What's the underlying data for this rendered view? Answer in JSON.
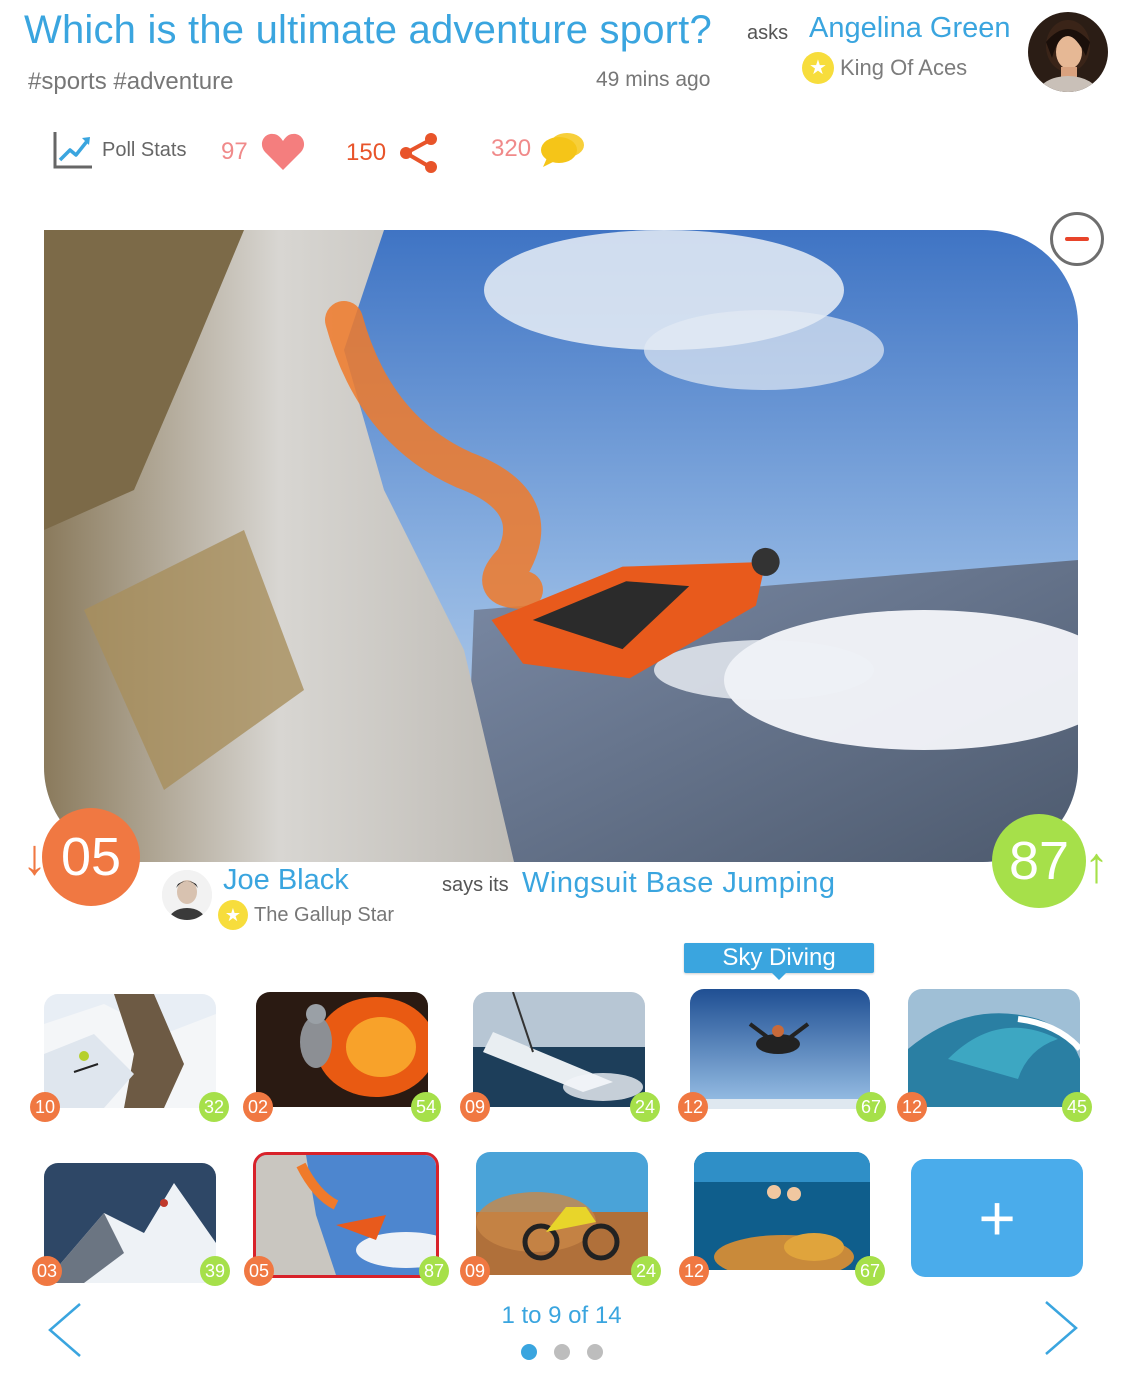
{
  "question": {
    "title": "Which is the ultimate adventure sport?",
    "asks_label": "asks",
    "hashtags": "#sports #adventure",
    "time_ago": "49 mins ago"
  },
  "author": {
    "name": "Angelina Green",
    "rank": "King Of Aces",
    "avatar_icon": "user-avatar-photo"
  },
  "stats": {
    "poll_stats_label": "Poll Stats",
    "likes": "97",
    "shares": "150",
    "comments": "320",
    "colors": {
      "likes": "#f08a8a",
      "shares": "#e8542a",
      "comments_bubble": "#f5c518"
    }
  },
  "main_entry": {
    "image_icon": "wingsuit-photo",
    "down_votes": "05",
    "up_votes": "87",
    "answerer_name": "Joe Black",
    "answerer_rank": "The Gallup Star",
    "says_label": "says its",
    "answer": "Wingsuit Base Jumping"
  },
  "tooltip": "Sky Diving",
  "thumbnails": [
    {
      "icon": "skiing-photo",
      "down": "10",
      "up": "32"
    },
    {
      "icon": "volcano-photo",
      "down": "02",
      "up": "54"
    },
    {
      "icon": "sailing-photo",
      "down": "09",
      "up": "24"
    },
    {
      "icon": "skydiving-photo",
      "down": "12",
      "up": "67"
    },
    {
      "icon": "surfing-photo",
      "down": "12",
      "up": "45"
    },
    {
      "icon": "mountaineering-photo",
      "down": "03",
      "up": "39"
    },
    {
      "icon": "wingsuit-photo",
      "down": "05",
      "up": "87",
      "selected": true
    },
    {
      "icon": "motocross-photo",
      "down": "09",
      "up": "24"
    },
    {
      "icon": "scuba-diving-photo",
      "down": "12",
      "up": "67"
    }
  ],
  "add_button_label": "+",
  "pagination": {
    "info": "1 to 9 of 14",
    "pages": 3,
    "active_page": 1
  },
  "colors": {
    "accent": "#3aa5df",
    "down": "#f07842",
    "up": "#a6e04a",
    "selected_border": "#d8222a"
  }
}
